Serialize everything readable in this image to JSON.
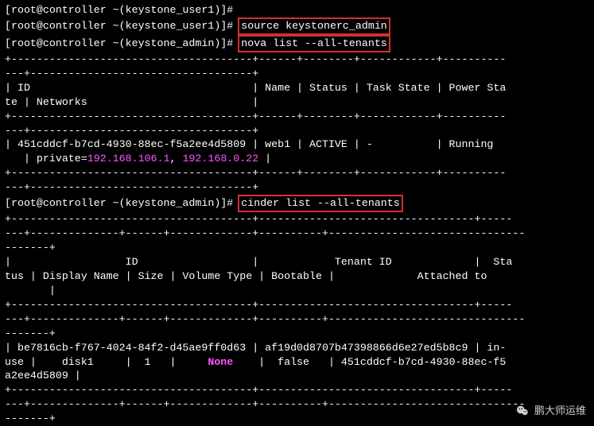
{
  "prompts": {
    "user1": "[root@controller ~(keystone_user1)]# ",
    "admin": "[root@controller ~(keystone_admin)]# "
  },
  "commands": {
    "source": "source keystonerc_admin",
    "nova": "nova list --all-tenants",
    "cinder": "cinder list --all-tenants"
  },
  "nova_table": {
    "sep_top": "+--------------------------------------+------+--------+------------+----------",
    "sep_cont": "---+-----------------------------------+",
    "hdr1": "| ID                                   | Name | Status | Task State | Power Sta",
    "hdr2": "te | Networks                          |",
    "row1": "| 451cddcf-b7cd-4930-88ec-f5a2ee4d5809 | web1 | ACTIVE | -          | Running  ",
    "row2a": "   | private=",
    "ip1": "192.168.106.1",
    "row2b": ", ",
    "ip2": "192.168.0.22",
    "row2c": " |"
  },
  "cinder_table": {
    "sep1a": "+--------------------------------------+----------------------------------+-----",
    "sep1b": "---+--------------+------+-------------+----------+-------------------------------",
    "sep1c": "-------+",
    "hdr1": "|                  ID                  |            Tenant ID             |  Sta",
    "hdr2": "tus | Display Name | Size | Volume Type | Bootable |             Attached to       ",
    "hdr3": "       |",
    "row1": "| be7816cb-f767-4024-84f2-d45ae9ff0d63 | af19d0d8707b47398866d6e27ed5b8c9 | in-",
    "row2a": "use |    disk1     |  1   |     ",
    "row2_none": "None",
    "row2b": "    |  false   | 451cddcf-b7cd-4930-88ec-f5",
    "row3": "a2ee4d5809 |"
  },
  "watermark": "鹏大师运维"
}
